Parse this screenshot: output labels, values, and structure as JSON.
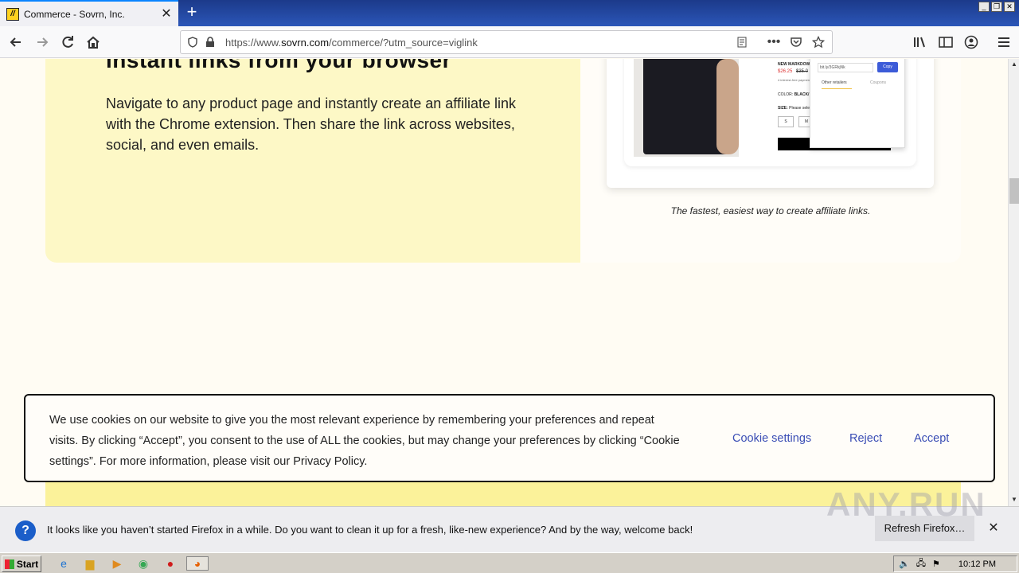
{
  "browser": {
    "tab_title": "Commerce - Sovrn, Inc.",
    "tab_favicon": "sovrn-logo-icon",
    "url_prefix": "https://www.",
    "url_domain": "sovrn.com",
    "url_path": "/commerce/?utm_source=viglink",
    "accent_color": "#0a84ff"
  },
  "page": {
    "heading_cut": "instant links from your browser",
    "body_text": "Navigate to any product page and instantly create an affiliate link with the Chrome extension. Then share the link across websites, social, and even emails.",
    "caption": "The fastest, easiest way to create affiliate links.",
    "product": {
      "title": "NEW MARKDOW",
      "price_new": "$26.25",
      "price_old": "$35.0",
      "note": "4 interest-free payment",
      "color_label": "COLOR:",
      "color_value": "BLACK/",
      "size_label": "SIZE:",
      "size_hint": "Please sele",
      "sizes": [
        "S",
        "M"
      ]
    },
    "extension_popup": {
      "link_value": "bit.ly/3GRkjNk",
      "copy_label": "Copy",
      "tab_other": "Other retailers",
      "tab_coupons": "Coupons"
    }
  },
  "cookie_banner": {
    "text": "We use cookies on our website to give you the most relevant experience by remembering your preferences and repeat visits. By clicking “Accept”, you consent to the use of ALL the cookies, but may change your preferences by clicking “Cookie settings”. For more information, please visit our Privacy Policy.",
    "settings_label": "Cookie settings",
    "reject_label": "Reject",
    "accept_label": "Accept",
    "link_color": "#3a4db5"
  },
  "notification": {
    "text": "It looks like you haven’t started Firefox in a while. Do you want to clean it up for a fresh, like-new experience? And by the way, welcome back!",
    "button_label": "Refresh Firefox…"
  },
  "watermark": "ANY.RUN",
  "taskbar": {
    "start_label": "Start",
    "clock": "10:12 PM"
  }
}
